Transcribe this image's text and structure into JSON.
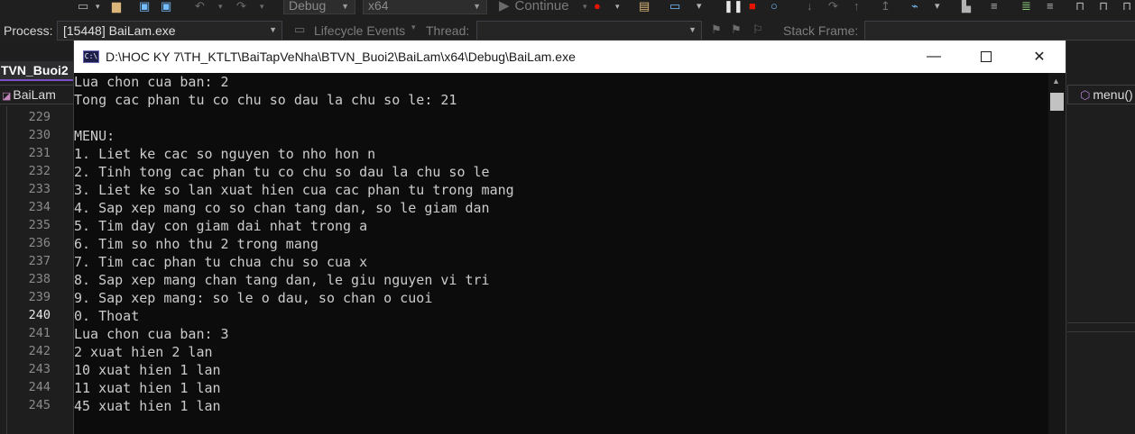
{
  "vs_toolbar": {
    "configuration": "Debug",
    "platform": "x64",
    "continue_label": "Continue"
  },
  "debug_bar": {
    "process_label": "Process:",
    "process_value": "[15448] BaiLam.exe",
    "lifecycle_label": "Lifecycle Events",
    "thread_label": "Thread:",
    "stack_frame_label": "Stack Frame:"
  },
  "editor": {
    "doc_tab": "TVN_Buoi2",
    "project_nav": "BaiLam",
    "member_nav": "menu()",
    "current_line": "240",
    "line_numbers": [
      "229",
      "230",
      "231",
      "232",
      "233",
      "234",
      "235",
      "236",
      "237",
      "238",
      "239",
      "240",
      "241",
      "242",
      "243",
      "244",
      "245"
    ]
  },
  "console": {
    "title": "D:\\HOC KY 7\\TH_KTLT\\BaiTapVeNha\\BTVN_Buoi2\\BaiLam\\x64\\Debug\\BaiLam.exe",
    "icon_text": "C:\\",
    "lines": [
      "Lua chon cua ban: 2",
      "Tong cac phan tu co chu so dau la chu so le: 21",
      "",
      "MENU:",
      "1. Liet ke cac so nguyen to nho hon n",
      "2. Tinh tong cac phan tu co chu so dau la chu so le",
      "3. Liet ke so lan xuat hien cua cac phan tu trong mang",
      "4. Sap xep mang co so chan tang dan, so le giam dan",
      "5. Tim day con giam dai nhat trong a",
      "6. Tim so nho thu 2 trong mang",
      "7. Tim cac phan tu chua chu so cua x",
      "8. Sap xep mang chan tang dan, le giu nguyen vi tri",
      "9. Sap xep mang: so le o dau, so chan o cuoi",
      "0. Thoat",
      "Lua chon cua ban: 3",
      "2 xuat hien 2 lan",
      "10 xuat hien 1 lan",
      "11 xuat hien 1 lan",
      "45 xuat hien 1 lan"
    ]
  }
}
